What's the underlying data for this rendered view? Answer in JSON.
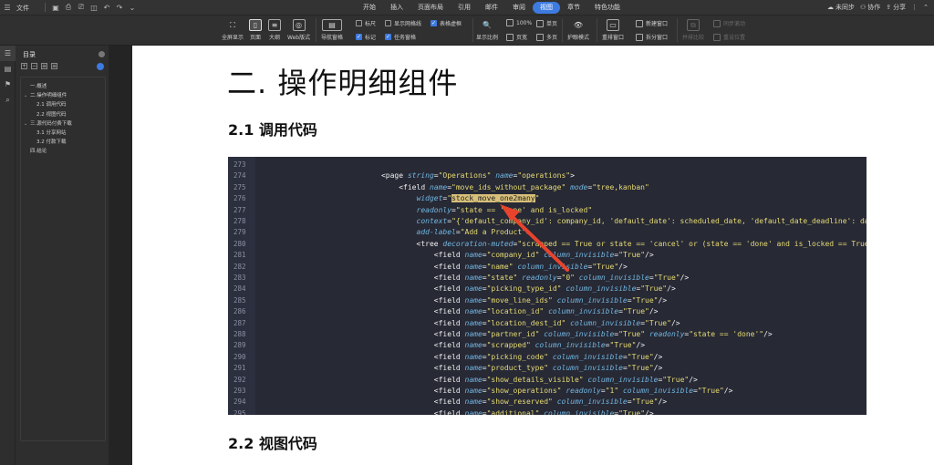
{
  "menubar": {
    "file_label": "文件",
    "tabs": [
      {
        "label": "开始",
        "active": false
      },
      {
        "label": "插入",
        "active": false
      },
      {
        "label": "页面布局",
        "active": false
      },
      {
        "label": "引用",
        "active": false
      },
      {
        "label": "邮件",
        "active": false
      },
      {
        "label": "审阅",
        "active": false
      },
      {
        "label": "视图",
        "active": true
      },
      {
        "label": "章节",
        "active": false
      },
      {
        "label": "特色功能",
        "active": false
      }
    ],
    "sync_label": "未同步",
    "collab_label": "协作",
    "share_label": "分享"
  },
  "ribbon": {
    "fullscreen": "全屏显示",
    "page_view": "页面",
    "outline": "大纲",
    "web_layout": "Web版式",
    "nav_pane": "导航窗格",
    "ruler": "标尺",
    "gridlines": "显示网格线",
    "table_gridlines": "表格虚框",
    "marks": "标记",
    "task_pane": "任务窗格",
    "zoom": "显示比例",
    "zoom_100": "100%",
    "single_page": "单页",
    "page_width": "页宽",
    "multi_page": "多页",
    "eye_mode": "护眼模式",
    "rearrange": "重排窗口",
    "new_window": "新建窗口",
    "split_window": "拆分窗口",
    "side_by_side": "并排比较",
    "sync_scroll": "同步滚动",
    "reset_position": "重设位置"
  },
  "nav": {
    "title": "目录",
    "items": [
      {
        "label": "一.概述",
        "level": 1,
        "chevron": false
      },
      {
        "label": "二.操作明细组件",
        "level": 1,
        "chevron": true
      },
      {
        "label": "2.1 调用代码",
        "level": 2,
        "chevron": false
      },
      {
        "label": "2.2 视图代码",
        "level": 2,
        "chevron": false
      },
      {
        "label": "三.源代码付费下载",
        "level": 1,
        "chevron": true
      },
      {
        "label": "3.1 分享网站",
        "level": 2,
        "chevron": false
      },
      {
        "label": "3.2 付款下载",
        "level": 2,
        "chevron": false
      },
      {
        "label": "四.结论",
        "level": 1,
        "chevron": false
      }
    ]
  },
  "doc": {
    "heading": "二.  操作明细组件",
    "section_1": "2.1 调用代码",
    "section_2": "2.2 视图代码"
  },
  "code": {
    "lines": [
      {
        "n": "273",
        "ind": 0,
        "parts": []
      },
      {
        "n": "274",
        "ind": 28,
        "parts": [
          [
            "tg",
            "<page "
          ],
          [
            "at",
            "string"
          ],
          [
            "op",
            "="
          ],
          [
            "sv",
            "\"Operations\""
          ],
          [
            "op",
            " "
          ],
          [
            "at",
            "name"
          ],
          [
            "op",
            "="
          ],
          [
            "sv",
            "\"operations\""
          ],
          [
            "tg",
            ">"
          ]
        ]
      },
      {
        "n": "275",
        "ind": 32,
        "parts": [
          [
            "tg",
            "<field "
          ],
          [
            "at",
            "name"
          ],
          [
            "op",
            "="
          ],
          [
            "sv",
            "\"move_ids_without_package\""
          ],
          [
            "op",
            " "
          ],
          [
            "at",
            "mode"
          ],
          [
            "op",
            "="
          ],
          [
            "sv",
            "\"tree,kanban\""
          ]
        ]
      },
      {
        "n": "276",
        "ind": 36,
        "parts": [
          [
            "at",
            "widget"
          ],
          [
            "op",
            "="
          ],
          [
            "sv",
            "\""
          ],
          [
            "hl",
            "stock_move_one2many"
          ],
          [
            "sv",
            "\""
          ]
        ]
      },
      {
        "n": "277",
        "ind": 36,
        "parts": [
          [
            "at",
            "readonly"
          ],
          [
            "op",
            "="
          ],
          [
            "sv",
            "\"state == 'done' and is_locked\""
          ]
        ]
      },
      {
        "n": "278",
        "ind": 36,
        "parts": [
          [
            "at",
            "context"
          ],
          [
            "op",
            "="
          ],
          [
            "sv",
            "\"{'default_company_id': company_id, 'default_date': scheduled_date, 'default_date_deadline': da"
          ]
        ]
      },
      {
        "n": "279",
        "ind": 36,
        "parts": [
          [
            "at",
            "add-label"
          ],
          [
            "op",
            "="
          ],
          [
            "sv",
            "\"Add a Product\">"
          ]
        ]
      },
      {
        "n": "280",
        "ind": 36,
        "parts": [
          [
            "tg",
            "<tree "
          ],
          [
            "at",
            "decoration-muted"
          ],
          [
            "op",
            "="
          ],
          [
            "sv",
            "\"scrapped == True or state == 'cancel' or (state == 'done' and is_locked == True"
          ]
        ]
      },
      {
        "n": "281",
        "ind": 40,
        "parts": [
          [
            "tg",
            "<field "
          ],
          [
            "at",
            "name"
          ],
          [
            "op",
            "="
          ],
          [
            "sv",
            "\"company_id\""
          ],
          [
            "op",
            " "
          ],
          [
            "at",
            "column_invisible"
          ],
          [
            "op",
            "="
          ],
          [
            "sv",
            "\"True\""
          ],
          [
            "tg",
            "/>"
          ]
        ]
      },
      {
        "n": "282",
        "ind": 40,
        "parts": [
          [
            "tg",
            "<field "
          ],
          [
            "at",
            "name"
          ],
          [
            "op",
            "="
          ],
          [
            "sv",
            "\"name\""
          ],
          [
            "op",
            " "
          ],
          [
            "at",
            "column_invisible"
          ],
          [
            "op",
            "="
          ],
          [
            "sv",
            "\"True\""
          ],
          [
            "tg",
            "/>"
          ]
        ]
      },
      {
        "n": "283",
        "ind": 40,
        "parts": [
          [
            "tg",
            "<field "
          ],
          [
            "at",
            "name"
          ],
          [
            "op",
            "="
          ],
          [
            "sv",
            "\"state\""
          ],
          [
            "op",
            " "
          ],
          [
            "at",
            "readonly"
          ],
          [
            "op",
            "="
          ],
          [
            "sv",
            "\"0\""
          ],
          [
            "op",
            " "
          ],
          [
            "at",
            "column_invisible"
          ],
          [
            "op",
            "="
          ],
          [
            "sv",
            "\"True\""
          ],
          [
            "tg",
            "/>"
          ]
        ]
      },
      {
        "n": "284",
        "ind": 40,
        "parts": [
          [
            "tg",
            "<field "
          ],
          [
            "at",
            "name"
          ],
          [
            "op",
            "="
          ],
          [
            "sv",
            "\"picking_type_id\""
          ],
          [
            "op",
            " "
          ],
          [
            "at",
            "column_invisible"
          ],
          [
            "op",
            "="
          ],
          [
            "sv",
            "\"True\""
          ],
          [
            "tg",
            "/>"
          ]
        ]
      },
      {
        "n": "285",
        "ind": 40,
        "parts": [
          [
            "tg",
            "<field "
          ],
          [
            "at",
            "name"
          ],
          [
            "op",
            "="
          ],
          [
            "sv",
            "\"move_line_ids\""
          ],
          [
            "op",
            " "
          ],
          [
            "at",
            "column_invisible"
          ],
          [
            "op",
            "="
          ],
          [
            "sv",
            "\"True\""
          ],
          [
            "tg",
            "/>"
          ]
        ]
      },
      {
        "n": "286",
        "ind": 40,
        "parts": [
          [
            "tg",
            "<field "
          ],
          [
            "at",
            "name"
          ],
          [
            "op",
            "="
          ],
          [
            "sv",
            "\"location_id\""
          ],
          [
            "op",
            " "
          ],
          [
            "at",
            "column_invisible"
          ],
          [
            "op",
            "="
          ],
          [
            "sv",
            "\"True\""
          ],
          [
            "tg",
            "/>"
          ]
        ]
      },
      {
        "n": "287",
        "ind": 40,
        "parts": [
          [
            "tg",
            "<field "
          ],
          [
            "at",
            "name"
          ],
          [
            "op",
            "="
          ],
          [
            "sv",
            "\"location_dest_id\""
          ],
          [
            "op",
            " "
          ],
          [
            "at",
            "column_invisible"
          ],
          [
            "op",
            "="
          ],
          [
            "sv",
            "\"True\""
          ],
          [
            "tg",
            "/>"
          ]
        ]
      },
      {
        "n": "288",
        "ind": 40,
        "parts": [
          [
            "tg",
            "<field "
          ],
          [
            "at",
            "name"
          ],
          [
            "op",
            "="
          ],
          [
            "sv",
            "\"partner_id\""
          ],
          [
            "op",
            " "
          ],
          [
            "at",
            "column_invisible"
          ],
          [
            "op",
            "="
          ],
          [
            "sv",
            "\"True\""
          ],
          [
            "op",
            " "
          ],
          [
            "at",
            "readonly"
          ],
          [
            "op",
            "="
          ],
          [
            "sv",
            "\"state == 'done'\""
          ],
          [
            "tg",
            "/>"
          ]
        ]
      },
      {
        "n": "289",
        "ind": 40,
        "parts": [
          [
            "tg",
            "<field "
          ],
          [
            "at",
            "name"
          ],
          [
            "op",
            "="
          ],
          [
            "sv",
            "\"scrapped\""
          ],
          [
            "op",
            " "
          ],
          [
            "at",
            "column_invisible"
          ],
          [
            "op",
            "="
          ],
          [
            "sv",
            "\"True\""
          ],
          [
            "tg",
            "/>"
          ]
        ]
      },
      {
        "n": "290",
        "ind": 40,
        "parts": [
          [
            "tg",
            "<field "
          ],
          [
            "at",
            "name"
          ],
          [
            "op",
            "="
          ],
          [
            "sv",
            "\"picking_code\""
          ],
          [
            "op",
            " "
          ],
          [
            "at",
            "column_invisible"
          ],
          [
            "op",
            "="
          ],
          [
            "sv",
            "\"True\""
          ],
          [
            "tg",
            "/>"
          ]
        ]
      },
      {
        "n": "291",
        "ind": 40,
        "parts": [
          [
            "tg",
            "<field "
          ],
          [
            "at",
            "name"
          ],
          [
            "op",
            "="
          ],
          [
            "sv",
            "\"product_type\""
          ],
          [
            "op",
            " "
          ],
          [
            "at",
            "column_invisible"
          ],
          [
            "op",
            "="
          ],
          [
            "sv",
            "\"True\""
          ],
          [
            "tg",
            "/>"
          ]
        ]
      },
      {
        "n": "292",
        "ind": 40,
        "parts": [
          [
            "tg",
            "<field "
          ],
          [
            "at",
            "name"
          ],
          [
            "op",
            "="
          ],
          [
            "sv",
            "\"show_details_visible\""
          ],
          [
            "op",
            " "
          ],
          [
            "at",
            "column_invisible"
          ],
          [
            "op",
            "="
          ],
          [
            "sv",
            "\"True\""
          ],
          [
            "tg",
            "/>"
          ]
        ]
      },
      {
        "n": "293",
        "ind": 40,
        "parts": [
          [
            "tg",
            "<field "
          ],
          [
            "at",
            "name"
          ],
          [
            "op",
            "="
          ],
          [
            "sv",
            "\"show_operations\""
          ],
          [
            "op",
            " "
          ],
          [
            "at",
            "readonly"
          ],
          [
            "op",
            "="
          ],
          [
            "sv",
            "\"1\""
          ],
          [
            "op",
            " "
          ],
          [
            "at",
            "column_invisible"
          ],
          [
            "op",
            "="
          ],
          [
            "sv",
            "\"True\""
          ],
          [
            "tg",
            "/>"
          ]
        ]
      },
      {
        "n": "294",
        "ind": 40,
        "parts": [
          [
            "tg",
            "<field "
          ],
          [
            "at",
            "name"
          ],
          [
            "op",
            "="
          ],
          [
            "sv",
            "\"show_reserved\""
          ],
          [
            "op",
            " "
          ],
          [
            "at",
            "column_invisible"
          ],
          [
            "op",
            "="
          ],
          [
            "sv",
            "\"True\""
          ],
          [
            "tg",
            "/>"
          ]
        ]
      },
      {
        "n": "295",
        "ind": 40,
        "parts": [
          [
            "tg",
            "<field "
          ],
          [
            "at",
            "name"
          ],
          [
            "op",
            "="
          ],
          [
            "sv",
            "\"additional\""
          ],
          [
            "op",
            " "
          ],
          [
            "at",
            "column_invisible"
          ],
          [
            "op",
            "="
          ],
          [
            "sv",
            "\"True\""
          ],
          [
            "tg",
            "/>"
          ]
        ]
      }
    ]
  },
  "colors": {
    "accent": "#3d7be0",
    "arrow": "#e8432c",
    "highlight": "#d8c07a"
  }
}
